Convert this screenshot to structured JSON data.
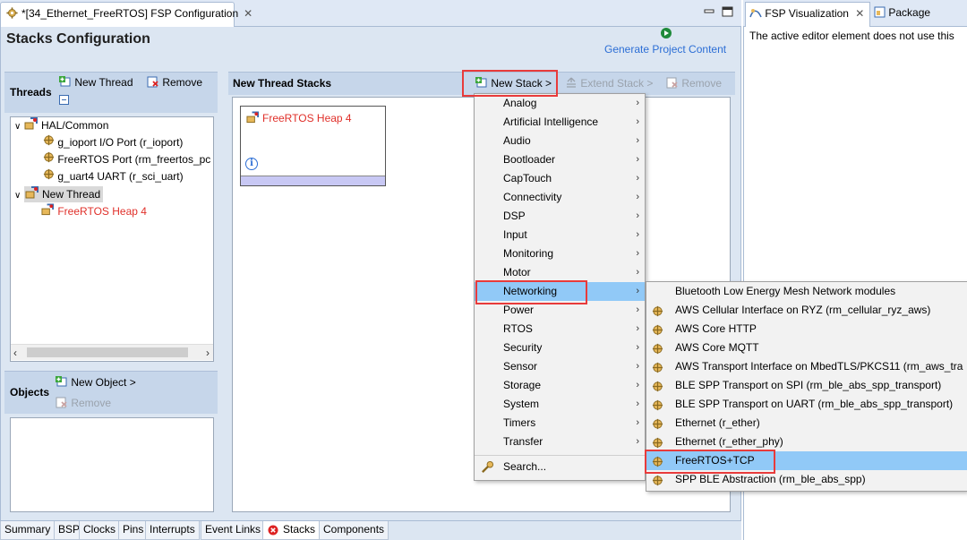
{
  "editor": {
    "tab_title": "*[34_Ethernet_FreeRTOS] FSP Configuration",
    "heading": "Stacks Configuration",
    "generate_label": "Generate Project Content"
  },
  "threads": {
    "title": "Threads",
    "new_thread": "New Thread",
    "remove": "Remove",
    "tree": [
      {
        "label": "HAL/Common",
        "color": "#000000"
      },
      {
        "label": "g_ioport I/O Port (r_ioport)",
        "color": "#000000"
      },
      {
        "label": "FreeRTOS Port (rm_freertos_pc",
        "color": "#000000"
      },
      {
        "label": "g_uart4 UART (r_sci_uart)",
        "color": "#000000"
      },
      {
        "label": "New Thread",
        "color": "#000000"
      },
      {
        "label": "FreeRTOS Heap 4",
        "color": "#e0302a"
      }
    ]
  },
  "objects": {
    "title": "Objects",
    "new_object": "New Object >",
    "remove": "Remove"
  },
  "stacks": {
    "title": "New Thread Stacks",
    "new_stack": "New Stack >",
    "extend_stack": "Extend Stack >",
    "remove": "Remove",
    "block_label": "FreeRTOS Heap 4"
  },
  "bottom_tabs": [
    "Summary",
    "BSP",
    "Clocks",
    "Pins",
    "Interrupts",
    "Event Links",
    "Stacks",
    "Components"
  ],
  "right_view": {
    "tab_fsp": "FSP Visualization",
    "tab_package": "Package",
    "message": "The active editor element does not use this"
  },
  "menu": {
    "items": [
      "Analog",
      "Artificial Intelligence",
      "Audio",
      "Bootloader",
      "CapTouch",
      "Connectivity",
      "DSP",
      "Input",
      "Monitoring",
      "Motor",
      "Networking",
      "Power",
      "RTOS",
      "Security",
      "Sensor",
      "Storage",
      "System",
      "Timers",
      "Transfer"
    ],
    "search": "Search...",
    "highlighted": "Networking"
  },
  "submenu": {
    "items": [
      {
        "label": "Bluetooth Low Energy Mesh Network modules",
        "icon": false
      },
      {
        "label": "AWS Cellular Interface on RYZ (rm_cellular_ryz_aws)",
        "icon": true
      },
      {
        "label": "AWS Core HTTP",
        "icon": true
      },
      {
        "label": "AWS Core MQTT",
        "icon": true
      },
      {
        "label": "AWS Transport Interface on MbedTLS/PKCS11 (rm_aws_tra",
        "icon": true
      },
      {
        "label": "BLE SPP Transport on SPI (rm_ble_abs_spp_transport)",
        "icon": true
      },
      {
        "label": "BLE SPP Transport on UART (rm_ble_abs_spp_transport)",
        "icon": true
      },
      {
        "label": "Ethernet (r_ether)",
        "icon": true
      },
      {
        "label": "Ethernet (r_ether_phy)",
        "icon": true
      },
      {
        "label": "FreeRTOS+TCP",
        "icon": true
      },
      {
        "label": "SPP BLE Abstraction (rm_ble_abs_spp)",
        "icon": true
      }
    ],
    "highlighted": "FreeRTOS+TCP"
  },
  "colors": {
    "accent_link": "#2c6ed5",
    "highlight": "#91c9f7",
    "red_callout": "#e83b3b",
    "component_red": "#e0302a"
  }
}
